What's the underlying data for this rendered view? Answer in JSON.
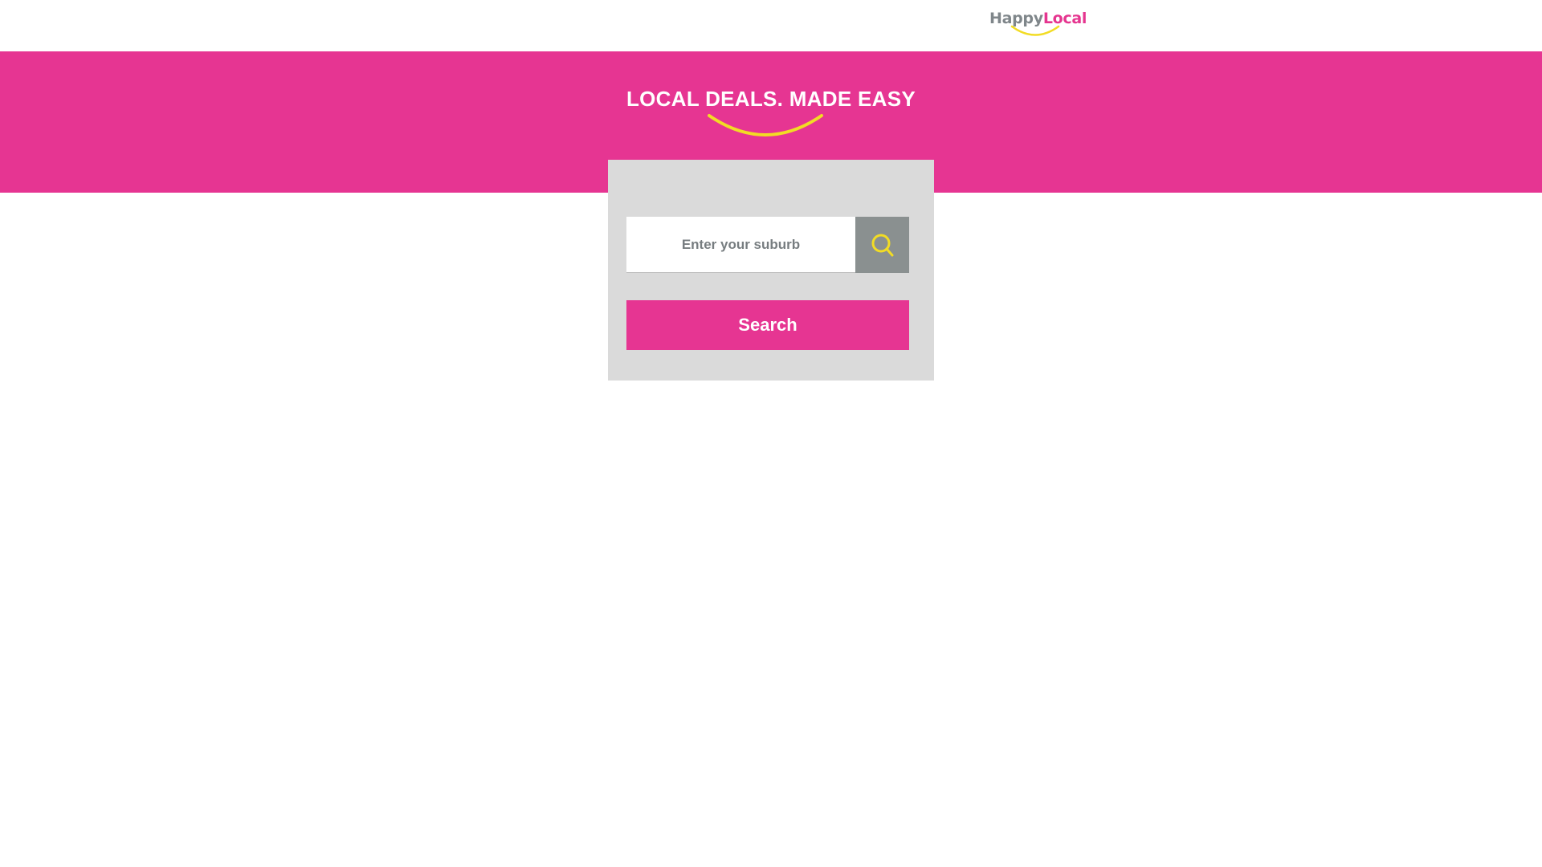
{
  "colors": {
    "brand_pink": "#e63592",
    "accent_yellow": "#f2dc24",
    "logo_grey": "#7f868a",
    "card_grey": "#dadada",
    "icon_button_grey": "#8a9090"
  },
  "header": {
    "logo": {
      "part1": "Happy",
      "part2": "Local",
      "icon": "smile-icon"
    }
  },
  "hero": {
    "tagline": "LOCAL DEALS. MADE EASY",
    "decoration_icon": "smile-icon"
  },
  "search": {
    "placeholder": "Enter your suburb",
    "value": "",
    "icon": "search-icon",
    "button_label": "Search"
  }
}
